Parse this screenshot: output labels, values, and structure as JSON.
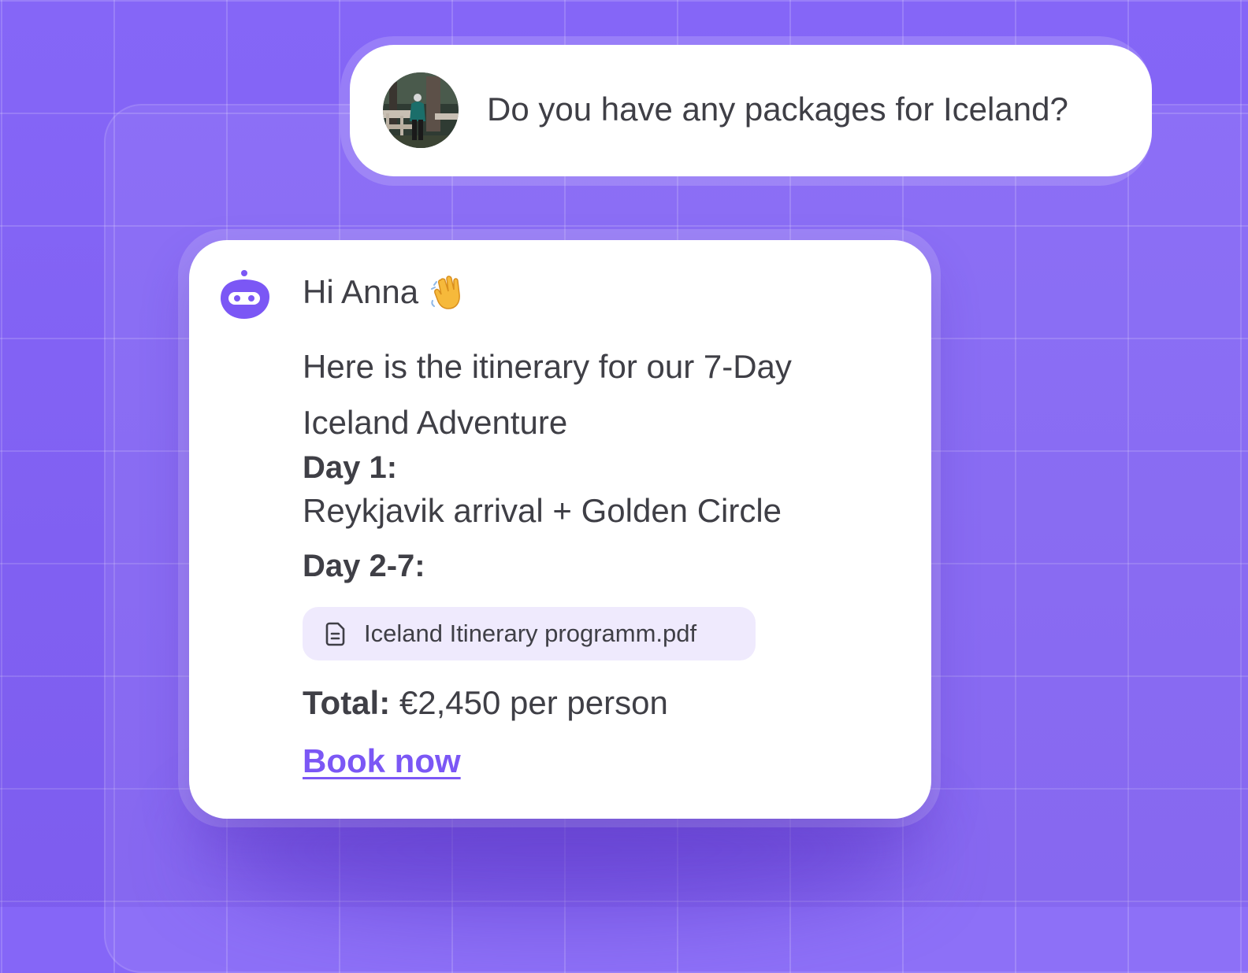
{
  "colors": {
    "background": "#8566f7",
    "accent": "#7b57f5",
    "attachment_bg": "#efeafd",
    "text": "#3f3f46",
    "wave_emoji": "#f6b93b"
  },
  "user_message": {
    "avatar_icon": "user-avatar-hiker-photo",
    "text": "Do you have any packages for Iceland?"
  },
  "bot_message": {
    "avatar_icon": "robot-icon",
    "greeting": "Hi Anna",
    "greeting_emoji_icon": "waving-hand-icon",
    "intro": "Here is the itinerary for our 7-Day Iceland Adventure",
    "day1_label": "Day 1:",
    "day1_desc": "Reykjavik arrival + Golden Circle",
    "day2_label": "Day 2-7:",
    "attachment": {
      "icon": "document-icon",
      "name": "Iceland Itinerary programm.pdf"
    },
    "total_label": "Total:",
    "total_value": "€2,450 per person",
    "cta_label": "Book now"
  }
}
